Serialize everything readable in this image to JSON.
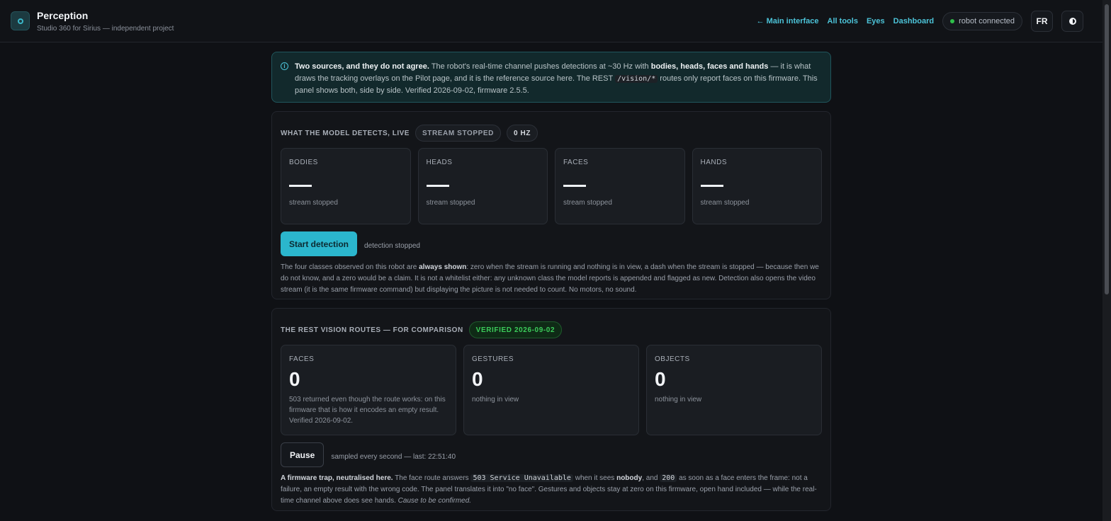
{
  "header": {
    "title": "Perception",
    "subtitle": "Studio 360 for Sirius — independent project",
    "nav": {
      "main_interface": "← Main interface",
      "all_tools": "All tools",
      "eyes": "Eyes",
      "dashboard": "Dashboard"
    },
    "status": "robot connected",
    "lang": "FR",
    "colors": {
      "accent": "#4cc3d8",
      "connected": "#2fbf4a"
    }
  },
  "info": {
    "lead": "Two sources, and they do not agree.",
    "t1": " The robot's real-time channel pushes detections at ~30 Hz with ",
    "b1": "bodies, heads, faces and hands",
    "t2": " — it is what draws the tracking overlays on the Pilot page, and it is the reference source here. The REST ",
    "code": "/vision/*",
    "t3": " routes only report faces on this firmware. This panel shows both, side by side. Verified 2026-09-02, firmware 2.5.5."
  },
  "live": {
    "title": "WHAT THE MODEL DETECTS, LIVE",
    "stream_pill": "STREAM STOPPED",
    "hz_pill": "0 HZ",
    "tiles": [
      {
        "label": "BODIES",
        "sub": "stream stopped"
      },
      {
        "label": "HEADS",
        "sub": "stream stopped"
      },
      {
        "label": "FACES",
        "sub": "stream stopped"
      },
      {
        "label": "HANDS",
        "sub": "stream stopped"
      }
    ],
    "start_button": "Start detection",
    "detection_status": "detection stopped",
    "note": {
      "t1": "The four classes observed on this robot are ",
      "b1": "always shown",
      "t2": ": zero when the stream is running and nothing is in view, a dash when the stream is stopped — because then we do not know, and a zero would be a claim. It is not a whitelist either: any unknown class the model reports is appended and flagged as new. Detection also opens the video stream (it is the same firmware command) but displaying the picture is not needed to count. No motors, no sound."
    }
  },
  "rest": {
    "title": "THE REST VISION ROUTES — FOR COMPARISON",
    "verified_pill": "VERIFIED 2026-09-02",
    "tiles": [
      {
        "label": "FACES",
        "value": "0",
        "desc": "503 returned even though the route works: on this firmware that is how it encodes an empty result. Verified 2026-09-02."
      },
      {
        "label": "GESTURES",
        "value": "0",
        "desc": "nothing in view"
      },
      {
        "label": "OBJECTS",
        "value": "0",
        "desc": "nothing in view"
      }
    ],
    "pause_button": "Pause",
    "sample_status": "sampled every second — last: 22:51:40",
    "note": {
      "b1": "A firmware trap, neutralised here.",
      "t1": " The face route answers ",
      "c1": "503 Service Unavailable",
      "t2": " when it sees ",
      "b2": "nobody",
      "t3": ", and ",
      "c2": "200",
      "t4": " as soon as a face enters the frame: not a failure, an empty result with the wrong code. The panel translates it into \"no face\". Gestures and objects stay at zero on this firmware, open hand included — while the real-time channel above does see hands. ",
      "i1": "Cause to be confirmed."
    }
  }
}
